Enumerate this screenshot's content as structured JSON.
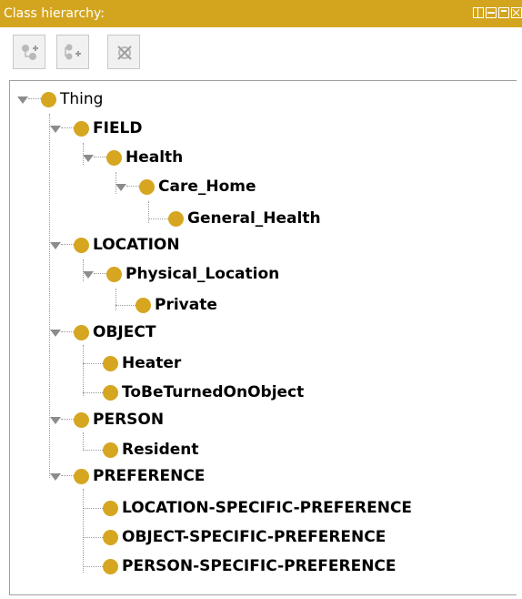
{
  "panel": {
    "title": "Class hierarchy:"
  },
  "toolbar": {
    "add_subclass_icon": "add-subclass-icon",
    "add_sibling_icon": "add-sibling-icon",
    "delete_class_icon": "delete-class-icon"
  },
  "tree": {
    "thing": "Thing",
    "field": "FIELD",
    "health": "Health",
    "care_home": "Care_Home",
    "general_health": "General_Health",
    "location": "LOCATION",
    "physical_location": "Physical_Location",
    "private": "Private",
    "object": "OBJECT",
    "heater": "Heater",
    "to_be_turned_on_object": "ToBeTurnedOnObject",
    "person": "PERSON",
    "resident": "Resident",
    "preference": "PREFERENCE",
    "location_specific_preference": "LOCATION-SPECIFIC-PREFERENCE",
    "object_specific_preference": "OBJECT-SPECIFIC-PREFERENCE",
    "person_specific_preference": "PERSON-SPECIFIC-PREFERENCE"
  },
  "colors": {
    "titlebar": "#d3a51f",
    "class_bullet": "#d6a620"
  }
}
